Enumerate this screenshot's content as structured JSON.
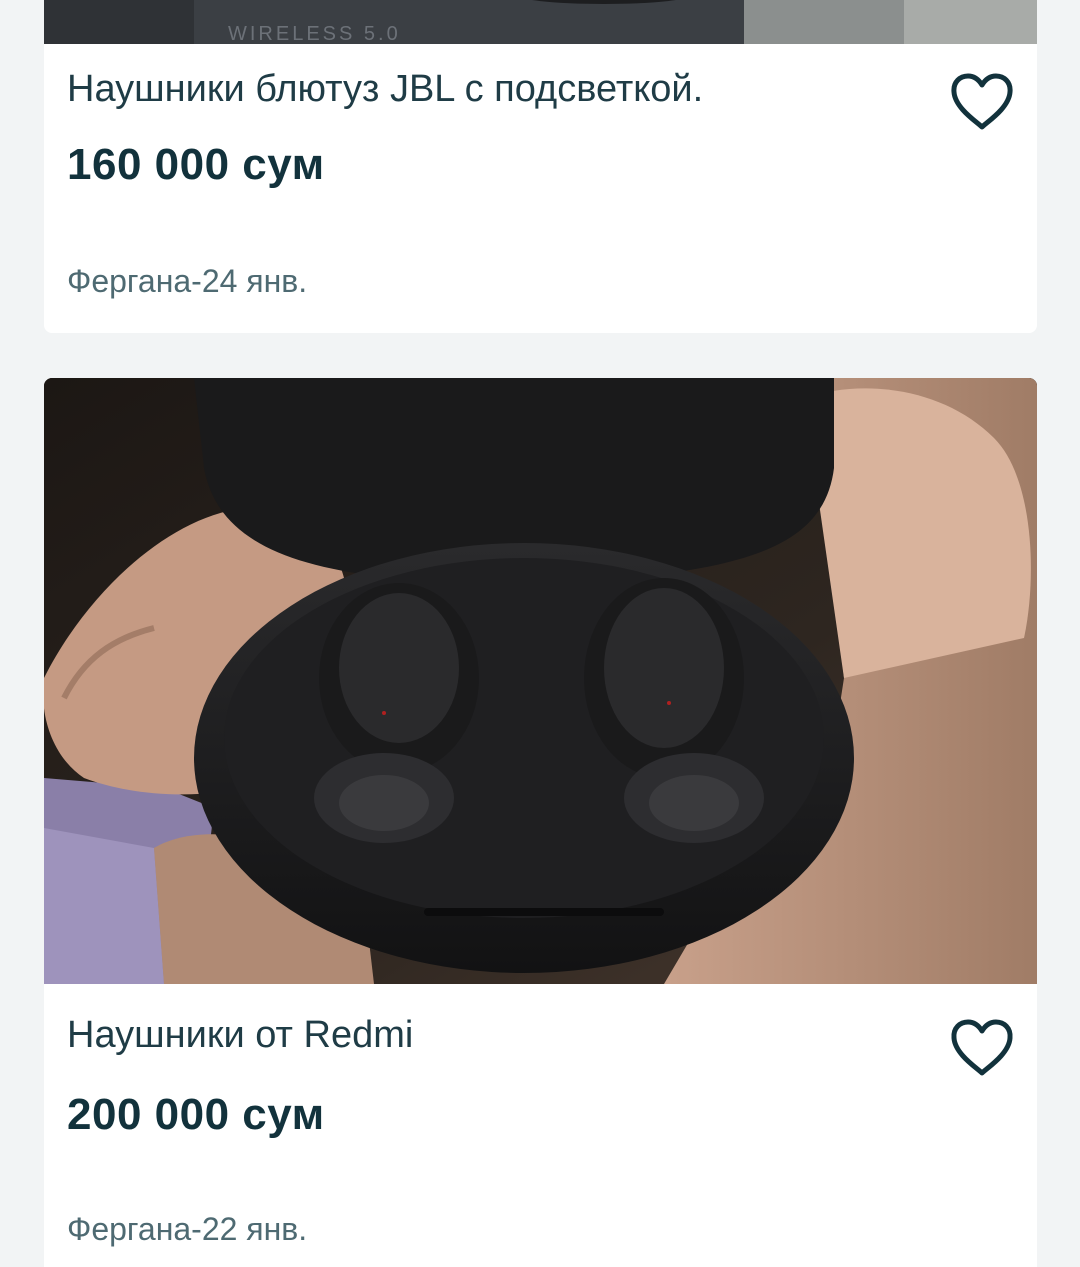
{
  "listings": [
    {
      "photo_caption": "WIRELESS 5.0",
      "title": "Наушники блютуз JBL с подсветкой.",
      "price": "160 000 сум",
      "meta": "Фергана-24 янв."
    },
    {
      "title": "Наушники от Redmi",
      "price": "200 000 сум",
      "meta": "Фергана-22 янв."
    }
  ],
  "colors": {
    "background": "#f2f4f5",
    "title": "#1f3c46",
    "price": "#12323c",
    "meta": "#4e6a72",
    "heart": "#12323c"
  },
  "icons": {
    "favorite": "heart-outline-icon"
  }
}
